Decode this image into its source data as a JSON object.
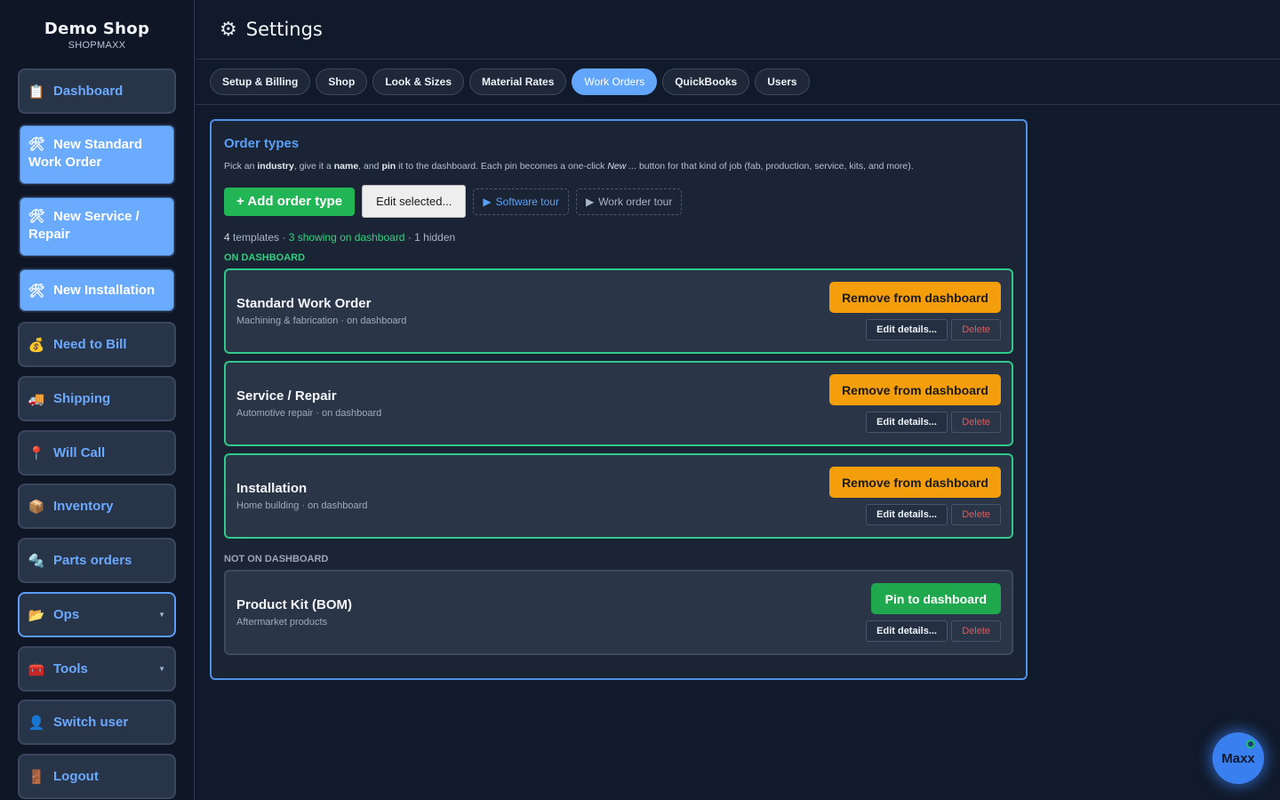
{
  "brand": {
    "name": "Demo Shop",
    "sub": "SHOPMAXX"
  },
  "sidebar": {
    "items": [
      {
        "label": "Dashboard",
        "icon": "clipboard-icon"
      },
      {
        "label": "New Standard Work Order",
        "icon": "tools-icon"
      },
      {
        "label": "New Service / Repair",
        "icon": "tools-icon"
      },
      {
        "label": "New Installation",
        "icon": "tools-icon"
      },
      {
        "label": "Need to Bill",
        "icon": "money-bag-icon"
      },
      {
        "label": "Shipping",
        "icon": "truck-icon"
      },
      {
        "label": "Will Call",
        "icon": "pin-icon"
      },
      {
        "label": "Inventory",
        "icon": "box-icon"
      },
      {
        "label": "Parts orders",
        "icon": "parts-icon"
      },
      {
        "label": "Ops",
        "icon": "folder-icon"
      },
      {
        "label": "Tools",
        "icon": "toolbox-icon"
      },
      {
        "label": "Switch user",
        "icon": "user-icon"
      },
      {
        "label": "Logout",
        "icon": "door-icon"
      }
    ]
  },
  "header": {
    "title": "Settings"
  },
  "tabs": [
    {
      "label": "Setup & Billing"
    },
    {
      "label": "Shop"
    },
    {
      "label": "Look & Sizes"
    },
    {
      "label": "Material Rates"
    },
    {
      "label": "Work Orders",
      "active": true
    },
    {
      "label": "QuickBooks"
    },
    {
      "label": "Users"
    }
  ],
  "panel": {
    "title": "Order types",
    "desc": {
      "p1": "Pick an ",
      "b1": "industry",
      "p2": ", give it a ",
      "b2": "name",
      "p3": ", and ",
      "b3": "pin",
      "p4": " it to the dashboard. Each pin becomes a one-click ",
      "i1": "New",
      "p5": " ... button for that kind of job (fab, production, service, kits, and more)."
    },
    "add_label": "+ Add order type",
    "edit_selected_label": "Edit selected...",
    "software_tour_label": "Software tour",
    "work_order_tour_label": "Work order tour",
    "counts": {
      "templates_num": "4",
      "templates_text": " templates · ",
      "showing": "3 showing on dashboard",
      "hidden": " · 1 hidden"
    },
    "on_label": "ON DASHBOARD",
    "off_label": "NOT ON DASHBOARD",
    "on_cards": [
      {
        "name": "Standard Work Order",
        "sub": "Machining & fabrication · on dashboard",
        "action": "Remove from dashboard",
        "edit": "Edit details...",
        "delete": "Delete"
      },
      {
        "name": "Service / Repair",
        "sub": "Automotive repair · on dashboard",
        "action": "Remove from dashboard",
        "edit": "Edit details...",
        "delete": "Delete"
      },
      {
        "name": "Installation",
        "sub": "Home building · on dashboard",
        "action": "Remove from dashboard",
        "edit": "Edit details...",
        "delete": "Delete"
      }
    ],
    "off_cards": [
      {
        "name": "Product Kit (BOM)",
        "sub": "Aftermarket products",
        "action": "Pin to dashboard",
        "edit": "Edit details...",
        "delete": "Delete"
      }
    ]
  },
  "assistant": {
    "label": "Maxx"
  },
  "colors": {
    "accent": "#62a6fb",
    "on_dashboard": "#30c98a",
    "remove": "#f59e0b",
    "pin": "#1fa84e",
    "add": "#22b556",
    "delete": "#e25a5a"
  }
}
